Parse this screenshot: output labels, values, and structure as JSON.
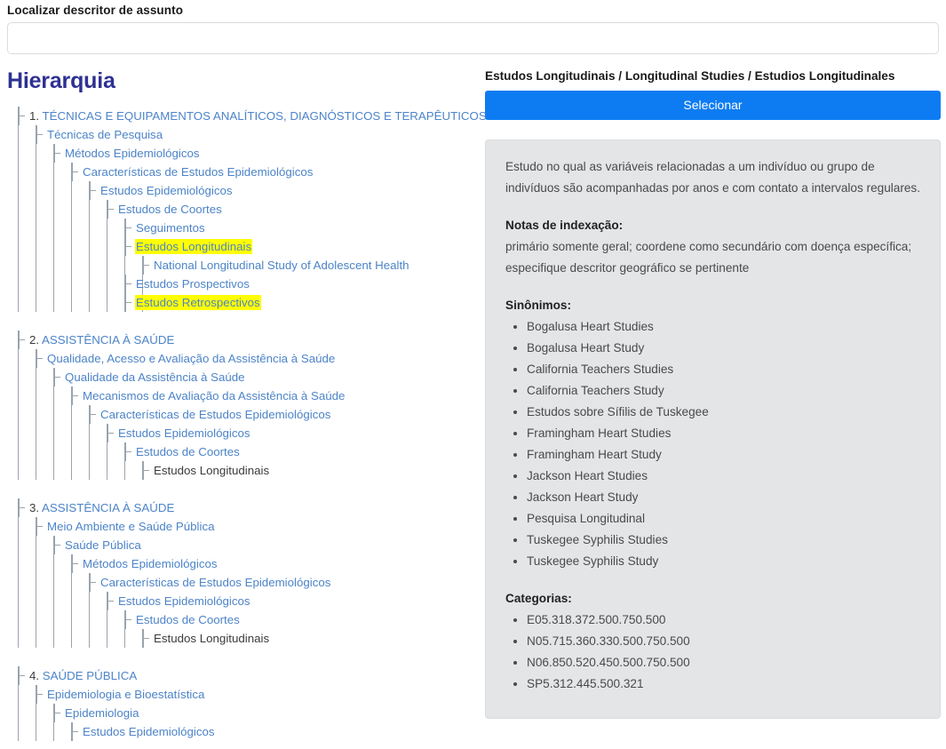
{
  "search": {
    "label": "Localizar descritor de assunto",
    "value": "",
    "placeholder": ""
  },
  "hierarchy": {
    "title": "Hierarquia",
    "blocks": [
      {
        "nodes": [
          {
            "label": "1. TÉCNICAS E EQUIPAMENTOS ANALÍTICOS, DIAGNÓSTICOS E TERAPÊUTICOS",
            "depth": 0,
            "link": true,
            "highlight": false,
            "numbered": true
          },
          {
            "label": "Técnicas de Pesquisa",
            "depth": 1,
            "link": true,
            "highlight": false
          },
          {
            "label": "Métodos Epidemiológicos",
            "depth": 2,
            "link": true,
            "highlight": false
          },
          {
            "label": "Características de Estudos Epidemiológicos",
            "depth": 3,
            "link": true,
            "highlight": false
          },
          {
            "label": "Estudos Epidemiológicos",
            "depth": 4,
            "link": true,
            "highlight": false
          },
          {
            "label": "Estudos de Coortes",
            "depth": 5,
            "link": true,
            "highlight": false
          },
          {
            "label": "Seguimentos",
            "depth": 6,
            "link": true,
            "highlight": false
          },
          {
            "label": "Estudos Longitudinais",
            "depth": 6,
            "link": true,
            "highlight": true
          },
          {
            "label": "National Longitudinal Study of Adolescent Health",
            "depth": 7,
            "link": true,
            "highlight": false
          },
          {
            "label": "Estudos Prospectivos",
            "depth": 6,
            "link": true,
            "highlight": false
          },
          {
            "label": "Estudos Retrospectivos",
            "depth": 6,
            "link": true,
            "highlight": true
          }
        ]
      },
      {
        "nodes": [
          {
            "label": "2. ASSISTÊNCIA À SAÚDE",
            "depth": 0,
            "link": true,
            "highlight": false,
            "numbered": true
          },
          {
            "label": "Qualidade, Acesso e Avaliação da Assistência à Saúde",
            "depth": 1,
            "link": true,
            "highlight": false
          },
          {
            "label": "Qualidade da Assistência à Saúde",
            "depth": 2,
            "link": true,
            "highlight": false
          },
          {
            "label": "Mecanismos de Avaliação da Assistência à Saúde",
            "depth": 3,
            "link": true,
            "highlight": false
          },
          {
            "label": "Características de Estudos Epidemiológicos",
            "depth": 4,
            "link": true,
            "highlight": false
          },
          {
            "label": "Estudos Epidemiológicos",
            "depth": 5,
            "link": true,
            "highlight": false
          },
          {
            "label": "Estudos de Coortes",
            "depth": 6,
            "link": true,
            "highlight": false
          },
          {
            "label": "Estudos Longitudinais",
            "depth": 7,
            "link": false,
            "highlight": false
          }
        ]
      },
      {
        "nodes": [
          {
            "label": "3. ASSISTÊNCIA À SAÚDE",
            "depth": 0,
            "link": true,
            "highlight": false,
            "numbered": true
          },
          {
            "label": "Meio Ambiente e Saúde Pública",
            "depth": 1,
            "link": true,
            "highlight": false
          },
          {
            "label": "Saúde Pública",
            "depth": 2,
            "link": true,
            "highlight": false
          },
          {
            "label": "Métodos Epidemiológicos",
            "depth": 3,
            "link": true,
            "highlight": false
          },
          {
            "label": "Características de Estudos Epidemiológicos",
            "depth": 4,
            "link": true,
            "highlight": false
          },
          {
            "label": "Estudos Epidemiológicos",
            "depth": 5,
            "link": true,
            "highlight": false
          },
          {
            "label": "Estudos de Coortes",
            "depth": 6,
            "link": true,
            "highlight": false
          },
          {
            "label": "Estudos Longitudinais",
            "depth": 7,
            "link": false,
            "highlight": false
          }
        ]
      },
      {
        "nodes": [
          {
            "label": "4. SAÚDE PÚBLICA",
            "depth": 0,
            "link": true,
            "highlight": false,
            "numbered": true
          },
          {
            "label": "Epidemiologia e Bioestatística",
            "depth": 1,
            "link": true,
            "highlight": false
          },
          {
            "label": "Epidemiologia",
            "depth": 2,
            "link": true,
            "highlight": false
          },
          {
            "label": "Estudos Epidemiológicos",
            "depth": 3,
            "link": true,
            "highlight": false
          }
        ]
      }
    ]
  },
  "descriptor": {
    "title": "Estudos Longitudinais / Longitudinal Studies / Estudios Longitudinales",
    "select_label": "Selecionar",
    "definition": "Estudo no qual as variáveis relacionadas a um indivíduo ou grupo de indivíduos são acompanhadas por anos e com contato a intervalos regulares.",
    "indexing_notes_head": "Notas de indexação:",
    "indexing_notes": "primário somente geral; coordene como secundário com doença específica; especifique descritor geográfico se pertinente",
    "synonyms_head": "Sinônimos:",
    "synonyms": [
      "Bogalusa Heart Studies",
      "Bogalusa Heart Study",
      "California Teachers Studies",
      "California Teachers Study",
      "Estudos sobre Sífilis de Tuskegee",
      "Framingham Heart Studies",
      "Framingham Heart Study",
      "Jackson Heart Studies",
      "Jackson Heart Study",
      "Pesquisa Longitudinal",
      "Tuskegee Syphilis Studies",
      "Tuskegee Syphilis Study"
    ],
    "categories_head": "Categorias:",
    "categories": [
      "E05.318.372.500.750.500",
      "N05.715.360.330.500.750.500",
      "N06.850.520.450.500.750.500",
      "SP5.312.445.500.321"
    ]
  },
  "colors": {
    "link": "#4d84c8",
    "heading": "#2e3192",
    "accent_button": "#0d7cf2",
    "highlight": "#ffff00",
    "panel_bg": "#e3e5e7",
    "tree_line": "#9aa3ad"
  }
}
